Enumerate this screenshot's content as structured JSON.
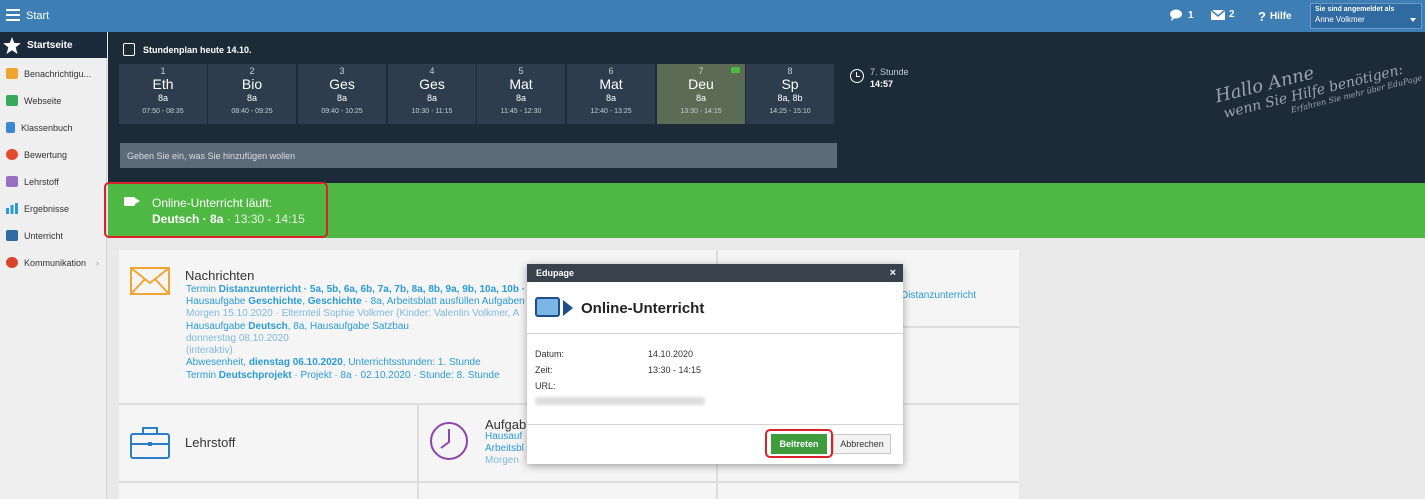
{
  "topbar": {
    "start_label": "Start",
    "chat_count": "1",
    "mail_count": "2",
    "help_label": "Hilfe",
    "logged_in_label": "Sie sind angemeldet als",
    "user_name": "Anne Volkmer"
  },
  "sidebar": {
    "items": [
      {
        "label": "Startseite",
        "icon": "star-icon"
      },
      {
        "label": "Benachrichtigu...",
        "icon": "envelope-icon",
        "color": "#f0a533"
      },
      {
        "label": "Webseite",
        "icon": "house-icon",
        "color": "#3aa85a"
      },
      {
        "label": "Klassenbuch",
        "icon": "book-icon",
        "color": "#3b87d4"
      },
      {
        "label": "Bewertung",
        "icon": "grade-icon",
        "color": "#e24b2b"
      },
      {
        "label": "Lehrstoff",
        "icon": "materials-icon",
        "color": "#9a6ec0"
      },
      {
        "label": "Ergebnisse",
        "icon": "bar-chart-icon",
        "color": "#2b9bd8"
      },
      {
        "label": "Unterricht",
        "icon": "class-icon",
        "color": "#2f6aa0"
      },
      {
        "label": "Kommunikation",
        "icon": "chat-icon",
        "color": "#d9442b"
      }
    ]
  },
  "timetable": {
    "title": "Stundenplan heute 14.10.",
    "periods": [
      {
        "num": "1",
        "subject": "Eth",
        "class": "8a",
        "time": "07:50 - 08:35"
      },
      {
        "num": "2",
        "subject": "Bio",
        "class": "8a",
        "time": "08:40 - 09:25"
      },
      {
        "num": "3",
        "subject": "Ges",
        "class": "8a",
        "time": "09:40 - 10:25"
      },
      {
        "num": "4",
        "subject": "Ges",
        "class": "8a",
        "time": "10:30 - 11:15"
      },
      {
        "num": "5",
        "subject": "Mat",
        "class": "8a",
        "time": "11:45 - 12:30"
      },
      {
        "num": "6",
        "subject": "Mat",
        "class": "8a",
        "time": "12:40 - 13:25"
      },
      {
        "num": "7",
        "subject": "Deu",
        "class": "8a",
        "time": "13:30 - 14:15",
        "current": true
      },
      {
        "num": "8",
        "subject": "Sp",
        "class": "8a, 8b",
        "time": "14:25 - 15:10"
      }
    ],
    "next_label": "7. Stunde",
    "next_time": "14:57",
    "input_placeholder": "Geben Sie ein, was Sie hinzufügen wollen"
  },
  "hello": {
    "line1": "Hallo Anne",
    "line2": "wenn Sie Hilfe benötigen:",
    "line3": "Erfahren Sie mehr über EduPage"
  },
  "banner": {
    "title": "Online-Unterricht läuft:",
    "subject": "Deutsch",
    "sep1": " · ",
    "class": "8a",
    "time": " · 13:30 - 14:15"
  },
  "tiles": {
    "messages": {
      "title": "Nachrichten",
      "lines": [
        {
          "pre": "Termin ",
          "bold": "Distanzunterricht",
          "post": " · 5a, 5b, 6a, 6b, 7a, 7b, 8a, 8b, 9a, 9b, 10a, 10b ·"
        },
        {
          "pre": "Hausaufgabe ",
          "bold": "Geschichte",
          "mid": ", ",
          "bold2": "Geschichte",
          "post": " · 8a, Arbeitsblatt ausfüllen Aufgaben"
        },
        {
          "muted": "Morgen 15.10.2020 · Elternteil Sophie Volkmer (Kinder: Valentin Volkmer, A"
        },
        {
          "pre": "Hausaufgabe ",
          "bold": "Deutsch",
          "post": ", 8a, Hausaufgabe Satzbau"
        },
        {
          "muted": "donnerstag 08.10.2020"
        },
        {
          "muted": "(interaktiv)"
        },
        {
          "pre": "Abwesenheit, ",
          "bold": "dienstag 06.10.2020",
          "post": ", Unterrichtsstunden: 1. Stunde"
        },
        {
          "pre": "Termin ",
          "bold": "Deutschprojekt",
          "post": " · Projekt · 8a · 02.10.2020 · Stunde: 8. Stunde"
        }
      ]
    },
    "right_partial": "Distanzunterricht",
    "materials_title": "Lehrstoff",
    "tasks": {
      "title": "Aufgab",
      "line1": "Hausauf",
      "line2": "Arbeitsbl",
      "line3": "Morgen"
    }
  },
  "dialog": {
    "header": "Edupage",
    "close": "×",
    "title": "Online-Unterricht",
    "date_label": "Datum:",
    "date_value": "14.10.2020",
    "time_label": "Zeit:",
    "time_value": "13:30 - 14:15",
    "url_label": "URL:",
    "join_label": "Beitreten",
    "cancel_label": "Abbrechen"
  }
}
